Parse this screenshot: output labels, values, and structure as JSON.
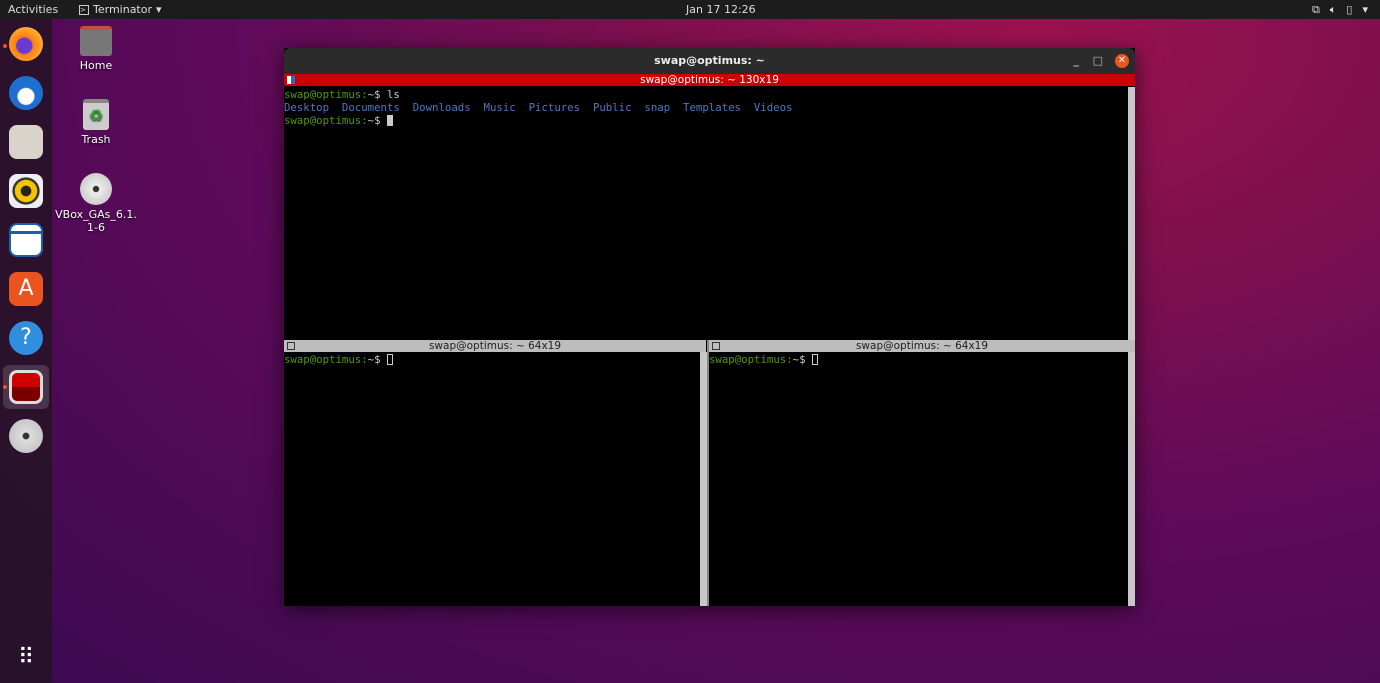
{
  "topbar": {
    "activities": "Activities",
    "app_name": "Terminator",
    "clock": "Jan 17  12:26"
  },
  "dock": [
    "firefox",
    "thunderbird",
    "files",
    "rhythmbox",
    "libreoffice-writer",
    "software",
    "help",
    "terminator",
    "dvd",
    "show-applications"
  ],
  "desktop": {
    "home": "Home",
    "trash": "Trash",
    "vbox": "VBox_GAs_6.1.1-6"
  },
  "window": {
    "title": "swap@optimus: ~",
    "top_pane": {
      "header": "swap@optimus: ~ 130x19",
      "prompt": "swap@optimus:",
      "path": "~$ ",
      "command": "ls",
      "listing": [
        "Desktop",
        "Documents",
        "Downloads",
        "Music",
        "Pictures",
        "Public",
        "snap",
        "Templates",
        "Videos"
      ]
    },
    "bottom_left": {
      "header": "swap@optimus: ~ 64x19",
      "prompt": "swap@optimus:",
      "path": "~$ "
    },
    "bottom_right": {
      "header": "swap@optimus: ~ 64x19",
      "prompt": "swap@optimus:",
      "path": "~$ "
    }
  },
  "colors": {
    "accent": "#e95420",
    "active_header": "#cc0000",
    "prompt": "#4e9a06",
    "dir": "#4d77c4"
  }
}
